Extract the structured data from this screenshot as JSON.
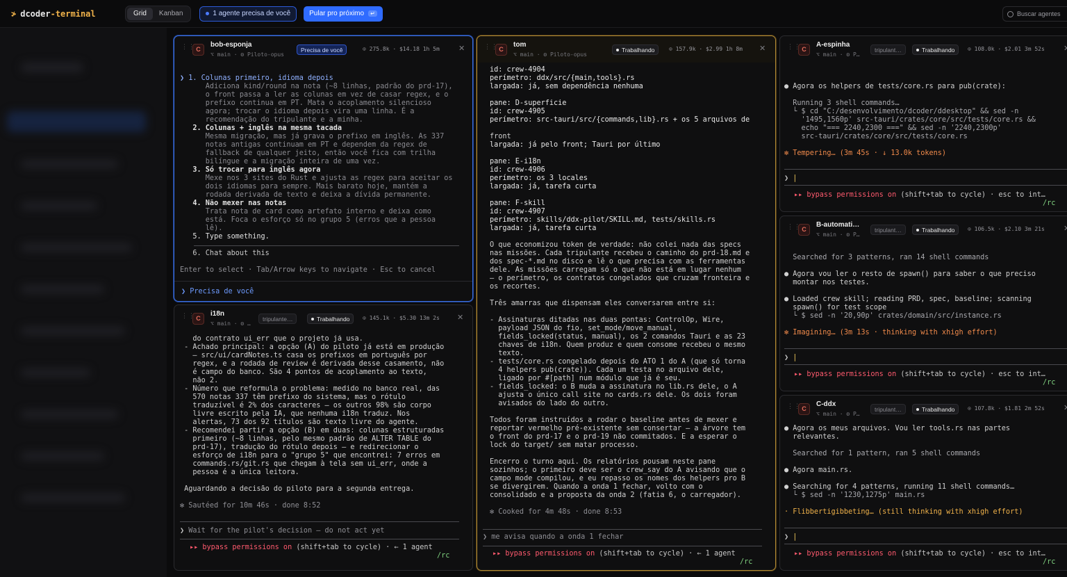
{
  "app": {
    "logo": "≯",
    "name_prefix": "dcoder",
    "name_suffix": "-terminal"
  },
  "view_tabs": [
    "Grid",
    "Kanban"
  ],
  "need_pill": "1 agente precisa de você",
  "next_button": {
    "label": "Pular pro próximo",
    "kbd": "↵"
  },
  "search_placeholder": "Buscar agentes",
  "colors": {
    "accent": "#f0b24a",
    "blue": "#2f6bff",
    "need": "#3b6fe0"
  },
  "panes": {
    "bob": {
      "name": "bob-esponja",
      "sub": "⌥ main · ⚙ Piloto-opus",
      "badge": "Precisa de você",
      "meta": "⊙ 275.8k · $14.18  1h 5m",
      "avatar": "C",
      "lines": [
        "❯ 1. Colunas primeiro, idioma depois",
        "      Adiciona kind/round na nota (~8 linhas, padrão do prd-17),",
        "      o front passa a ler as colunas em vez de casar regex, e o",
        "      prefixo continua em PT. Mata o acoplamento silencioso",
        "      agora; trocar o idioma depois vira uma linha. É a",
        "      recomendação do tripulante e a minha.",
        "   2. Colunas + inglês na mesma tacada",
        "      Mesma migração, mas já grava o prefixo em inglês. As 337",
        "      notas antigas continuam em PT e dependem da regex de",
        "      fallback de qualquer jeito, então você fica com trilha",
        "      bilíngue e a migração inteira de uma vez.",
        "   3. Só trocar para inglês agora",
        "      Mexe nos 3 sites do Rust e ajusta as regex para aceitar os",
        "      dois idiomas para sempre. Mais barato hoje, mantém a",
        "      rodada derivada de texto e deixa a dívida permanente.",
        "   4. Não mexer nas notas",
        "      Trata nota de card como artefato interno e deixa como",
        "      está. Foca o esforço só no grupo 5 (erros que a pessoa",
        "      lê).",
        "   5. Type something."
      ],
      "line6": "   6. Chat about this",
      "hint": "Enter to select · Tab/Arrow keys to navigate · Esc to cancel",
      "footer": "❯ Precisa de você"
    },
    "i18n": {
      "name": "i18n",
      "sub": "⌥ main · ⚙ …",
      "role": "tripulante…",
      "badge": "Trabalhando",
      "meta": "⊙ 145.1k · $5.30  13m 2s",
      "avatar": "C",
      "lines": [
        "   do contrato ui_err que o projeto já usa.",
        " - Achado principal: a opção (A) do piloto já está em produção",
        "   — src/ui/cardNotes.ts casa os prefixos em português por",
        "   regex, e a rodada de review é derivada desse casamento, não",
        "   é campo do banco. São 4 pontos de acoplamento ao texto,",
        "   não 2.",
        " - Número que reformula o problema: medido no banco real, das",
        "   570 notas 337 têm prefixo do sistema, mas o rótulo",
        "   traduzível é 2% dos caracteres — os outros 98% são corpo",
        "   livre escrito pela IA, que nenhuma i18n traduz. Nos",
        "   alertas, 73 dos 92 títulos são texto livre do agente.",
        " - Recomendei partir a opção (B) em duas: colunas estruturadas",
        "   primeiro (~8 linhas, pelo mesmo padrão de ALTER TABLE do",
        "   prd-17), tradução do rótulo depois — e redirecionar o",
        "   esforço de i18n para o \"grupo 5\" que encontrei: 7 erros em",
        "   commands.rs/git.rs que chegam à tela sem ui_err, onde a",
        "   pessoa é a única leitora.",
        "",
        " Aguardando a decisão do piloto para a segunda entrega.",
        "",
        "✻ Sautéed for 10m 46s · done 8:52"
      ],
      "input": "Wait for the pilot's decision — do not act yet",
      "bypass": "▸▸ bypass permissions on (shift+tab to cycle) · ← 1 agent",
      "rc": "/rc"
    },
    "tom": {
      "name": "tom",
      "sub": "⌥ main · ⚙ Piloto-opus",
      "badge": "Trabalhando",
      "meta": "⊙ 157.9k · $2.99  1h 8m",
      "avatar": "C",
      "lines": [
        "id: crew-4904",
        "perímetro: ddx/src/{main,tools}.rs",
        "largada: já, sem dependência nenhuma",
        "",
        "pane: D-superficie",
        "id: crew-4905",
        "perímetro: src-tauri/src/{commands,lib}.rs + os 5 arquivos de",
        "",
        "front",
        "largada: já pelo front; Tauri por último",
        "",
        "pane: E-i18n",
        "id: crew-4906",
        "perímetro: os 3 locales",
        "largada: já, tarefa curta",
        "",
        "pane: F-skill",
        "id: crew-4907",
        "perímetro: skills/ddx-pilot/SKILL.md, tests/skills.rs",
        "largada: já, tarefa curta",
        "",
        "O que economizou token de verdade: não colei nada das specs",
        "nas missões. Cada tripulante recebeu o caminho do prd-18.md e",
        "dos spec-*.md no disco e lê o que precisa com as ferramentas",
        "dele. As missões carregam só o que não está em lugar nenhum",
        "— o perímetro, os contratos congelados que cruzam fronteira e",
        "os recortes.",
        "",
        "Três amarras que dispensam eles conversarem entre si:",
        "",
        "- Assinaturas ditadas nas duas pontas: ControlOp, Wire,",
        "  payload JSON do fio, set_mode/move_manual,",
        "  fields_locked(status, manual), os 2 comandos Tauri e as 23",
        "  chaves de i18n. Quem produz e quem consome recebeu o mesmo",
        "  texto.",
        "- tests/core.rs congelado depois do ATO 1 do A (que só torna",
        "  4 helpers pub(crate)). Cada um testa no arquivo dele,",
        "  ligado por #[path] num módulo que já é seu.",
        "- fields_locked: o B muda a assinatura no lib.rs dele, o A",
        "  ajusta o único call site no cards.rs dele. Os dois foram",
        "  avisados do lado do outro.",
        "",
        "Todos foram instruídos a rodar o baseline antes de mexer e",
        "reportar vermelho pré-existente sem consertar — a árvore tem",
        "o front do prd-17 e o prd-19 não commitados. E a esperar o",
        "lock do target/ sem matar processo.",
        "",
        "Encerro o turno aqui. Os relatórios pousam neste pane",
        "sozinhos; o primeiro deve ser o crew_say do A avisando que o",
        "campo mode compilou, e eu repasso os nomes dos helpers pro B",
        "se divergirem. Quando a onda 1 fechar, volto com o",
        "consolidado e a proposta da onda 2 (fatia 6, o carregador).",
        "",
        "✻ Cooked for 4m 48s · done 8:53"
      ],
      "input": "me avisa quando a onda 1 fechar",
      "bypass": "▸▸ bypass permissions on (shift+tab to cycle) · ← 1 agent",
      "rc": "/rc"
    },
    "espinha": {
      "name": "A-espinha",
      "sub": "⌥ main · ⚙ P…",
      "role": "tripulant…",
      "badge": "Trabalhando",
      "meta": "⊙ 108.0k · $2.01  3m 52s",
      "avatar": "C",
      "lines": [
        "● Agora os helpers de tests/core.rs para pub(crate):",
        "",
        "  Running 3 shell commands…",
        "  └ $ cd \"C:/desenvolvimento/dcoder/ddesktop\" && sed -n",
        "    '1495,1560p' src-tauri/crates/core/src/tests/core.rs &&",
        "    echo \"=== 2240,2300 ===\" && sed -n '2240,2300p'",
        "    src-tauri/crates/core/src/tests/core.rs",
        "",
        "✻ Tempering… (3m 45s · ↓ 13.0k tokens)"
      ],
      "prompt": "❯ |",
      "bypass": "▸▸ bypass permissions on (shift+tab to cycle) · esc to int…",
      "rc": "/rc"
    },
    "automat": {
      "name": "B-automati…",
      "sub": "⌥ main · ⚙ P…",
      "role": "tripulant…",
      "badge": "Trabalhando",
      "meta": "⊙ 106.5k · $2.10  3m 21s",
      "avatar": "C",
      "lines": [
        "  Searched for 3 patterns, ran 14 shell commands",
        "",
        "● Agora vou ler o resto de spawn() para saber o que preciso",
        "  montar nos testes.",
        "",
        "● Loaded crew skill; reading PRD, spec, baseline; scanning",
        "  spawn() for test scope",
        "  └ $ sed -n '20,90p' crates/domain/src/instance.rs",
        "",
        "✻ Imagining… (3m 13s · thinking with xhigh effort)"
      ],
      "prompt": "❯ |",
      "bypass": "▸▸ bypass permissions on (shift+tab to cycle) · esc to int…",
      "rc": "/rc"
    },
    "cddx": {
      "name": "C-ddx",
      "sub": "⌥ main · ⚙ P…",
      "role": "tripulant…",
      "badge": "Trabalhando",
      "meta": "⊙ 107.8k · $1.81  2m 52s",
      "avatar": "C",
      "lines": [
        "● Agora os meus arquivos. Vou ler tools.rs nas partes",
        "  relevantes.",
        "",
        "  Searched for 1 pattern, ran 5 shell commands",
        "",
        "● Agora main.rs.",
        "",
        "● Searching for 4 patterns, running 11 shell commands…",
        "  └ $ sed -n '1230,1275p' main.rs",
        "",
        "· Flibbertigibbeting… (still thinking with xhigh effort)"
      ],
      "prompt": "❯ |",
      "bypass": "▸▸ bypass permissions on (shift+tab to cycle) · esc to int…",
      "rc": "/rc"
    }
  }
}
